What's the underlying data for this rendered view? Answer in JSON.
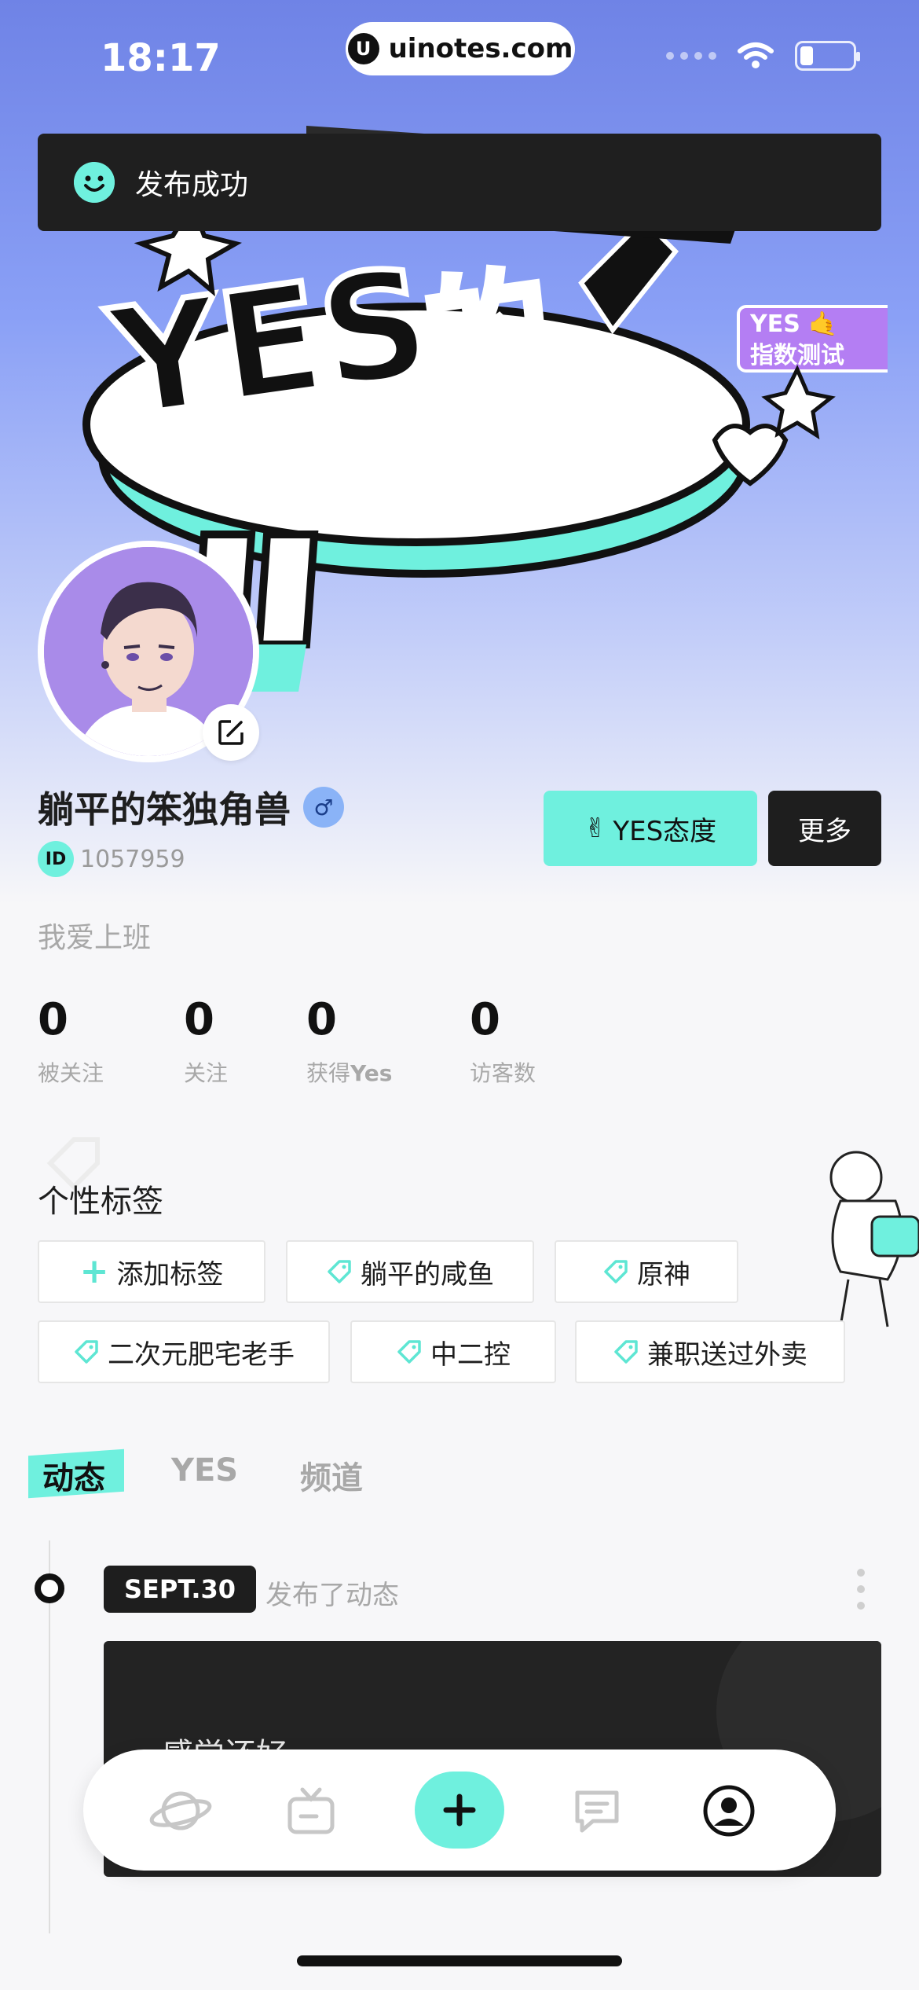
{
  "status_bar": {
    "time": "18:17",
    "url": "uinotes.com"
  },
  "toast": {
    "message": "发布成功"
  },
  "profile": {
    "username": "躺平的笨独角兽",
    "gender_symbol": "♂",
    "id_label": "ID",
    "id_value": "1057959",
    "bio": "我爱上班",
    "yes_button_label": "YES态度",
    "more_button_label": "更多"
  },
  "stats": [
    {
      "value": "0",
      "label": "被关注"
    },
    {
      "value": "0",
      "label": "关注"
    },
    {
      "value": "0",
      "label_prefix": "获得",
      "label_bold": "Yes"
    },
    {
      "value": "0",
      "label": "访客数"
    }
  ],
  "tags_section": {
    "title": "个性标签",
    "add_label": "添加标签",
    "tags": [
      "躺平的咸鱼",
      "原神",
      "二次元肥宅老手",
      "中二控",
      "兼职送过外卖"
    ]
  },
  "tabs": [
    "动态",
    "YES",
    "频道"
  ],
  "post": {
    "date": "SEPT.30",
    "meta": "发布了动态",
    "preview_text": "感觉还好"
  },
  "bottom_nav": [
    {
      "icon": "planet-icon"
    },
    {
      "icon": "tv-icon"
    },
    {
      "icon": "add-icon"
    },
    {
      "icon": "message-icon"
    },
    {
      "icon": "profile-icon"
    }
  ],
  "colors": {
    "accent": "#6ff0de",
    "dark": "#1e1e1e",
    "hero_top": "#6f83e6"
  }
}
